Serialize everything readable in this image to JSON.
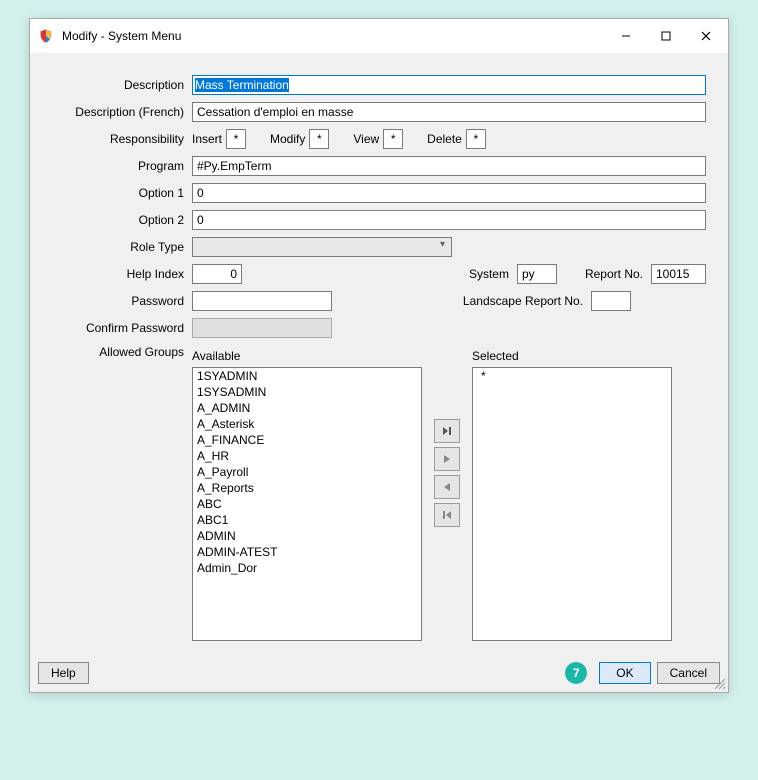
{
  "window": {
    "title": "Modify - System Menu"
  },
  "labels": {
    "description": "Description",
    "description_fr": "Description (French)",
    "responsibility": "Responsibility",
    "program": "Program",
    "option1": "Option 1",
    "option2": "Option 2",
    "role_type": "Role Type",
    "help_index": "Help Index",
    "system": "System",
    "report_no": "Report No.",
    "password": "Password",
    "landscape_report_no": "Landscape Report No.",
    "confirm_password": "Confirm Password",
    "allowed_groups": "Allowed Groups",
    "available": "Available",
    "selected": "Selected"
  },
  "values": {
    "description": "Mass Termination",
    "description_fr": "Cessation d'emploi en masse",
    "program": "#Py.EmpTerm",
    "option1": "0",
    "option2": "0",
    "help_index": "0",
    "system": "py",
    "report_no": "10015",
    "landscape_report_no": "",
    "selected_group": "*"
  },
  "responsibility": {
    "insert": {
      "label": "Insert",
      "value": "*"
    },
    "modify": {
      "label": "Modify",
      "value": "*"
    },
    "view": {
      "label": "View",
      "value": "*"
    },
    "delete": {
      "label": "Delete",
      "value": "*"
    }
  },
  "available_groups": [
    "1SYADMIN",
    "1SYSADMIN",
    "A_ADMIN",
    "A_Asterisk",
    "A_FINANCE",
    "A_HR",
    "A_Payroll",
    "A_Reports",
    "ABC",
    "ABC1",
    "ADMIN",
    "ADMIN-ATEST",
    "Admin_Dor"
  ],
  "buttons": {
    "help": "Help",
    "ok": "OK",
    "cancel": "Cancel"
  },
  "badge": "7"
}
